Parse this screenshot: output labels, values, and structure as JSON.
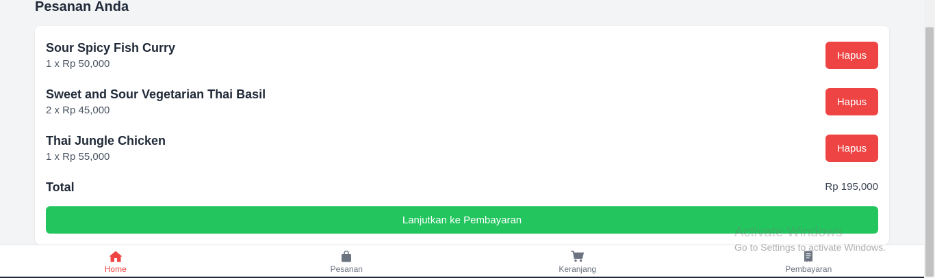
{
  "page": {
    "title": "Pesanan Anda"
  },
  "cart": {
    "items": [
      {
        "name": "Sour Spicy Fish Curry",
        "quantity_price": "1 x Rp 50,000",
        "remove_label": "Hapus"
      },
      {
        "name": "Sweet and Sour Vegetarian Thai Basil",
        "quantity_price": "2 x Rp 45,000",
        "remove_label": "Hapus"
      },
      {
        "name": "Thai Jungle Chicken",
        "quantity_price": "1 x Rp 55,000",
        "remove_label": "Hapus"
      }
    ],
    "total_label": "Total",
    "total_value": "Rp 195,000",
    "checkout_label": "Lanjutkan ke Pembayaran"
  },
  "nav": {
    "items": [
      {
        "label": "Home",
        "icon": "home-icon",
        "active": true
      },
      {
        "label": "Pesanan",
        "icon": "shopping-bag-icon",
        "active": false
      },
      {
        "label": "Keranjang",
        "icon": "cart-icon",
        "active": false
      },
      {
        "label": "Pembayaran",
        "icon": "receipt-icon",
        "active": false
      }
    ]
  },
  "watermark": {
    "line1": "Activate Windows",
    "line2": "Go to Settings to activate Windows."
  },
  "colors": {
    "danger": "#ef4444",
    "success": "#22c55e",
    "background": "#f3f4f6",
    "text": "#1f2937"
  }
}
